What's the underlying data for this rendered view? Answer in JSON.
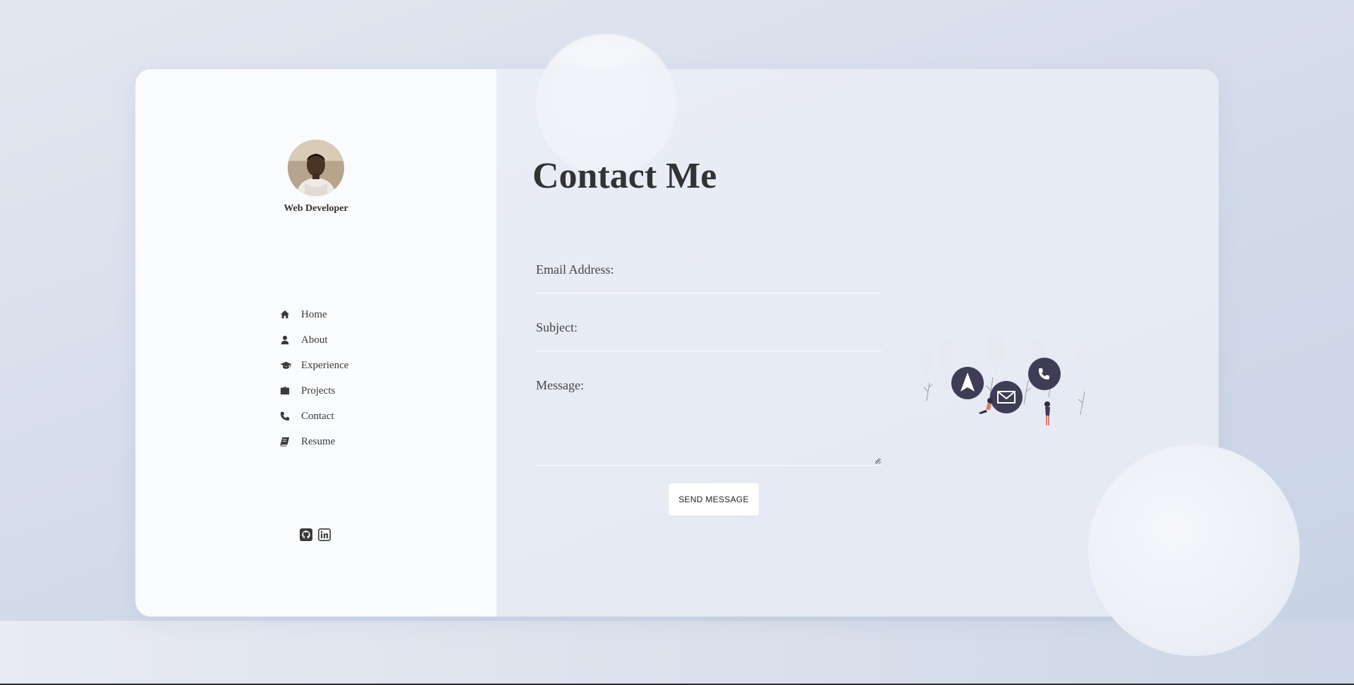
{
  "profile": {
    "role": "Web Developer",
    "avatar_alt": "profile-photo"
  },
  "nav": {
    "items": [
      {
        "label": "Home",
        "icon": "home-icon"
      },
      {
        "label": "About",
        "icon": "user-icon"
      },
      {
        "label": "Experience",
        "icon": "graduation-cap-icon"
      },
      {
        "label": "Projects",
        "icon": "briefcase-icon"
      },
      {
        "label": "Contact",
        "icon": "phone-icon"
      },
      {
        "label": "Resume",
        "icon": "book-icon"
      }
    ]
  },
  "social": [
    {
      "icon": "github-icon"
    },
    {
      "icon": "linkedin-icon"
    }
  ],
  "contact": {
    "title": "Contact Me",
    "email_label": "Email Address:",
    "email_value": "",
    "subject_label": "Subject:",
    "subject_value": "",
    "message_label": "Message:",
    "message_value": "",
    "send_label": "SEND MESSAGE"
  },
  "colors": {
    "text": "#3a3a3a",
    "illustration_dark": "#3f3d56",
    "illustration_accent": "#e07a6f"
  }
}
